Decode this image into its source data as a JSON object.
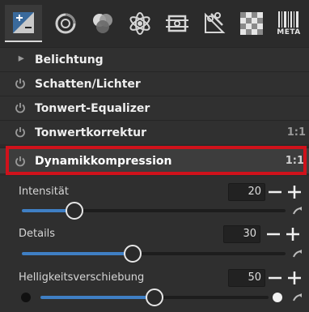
{
  "toolbar": {
    "tabs": [
      {
        "name": "exposure-tab-icon",
        "active": true
      },
      {
        "name": "detail-tab-icon",
        "active": false
      },
      {
        "name": "color-tab-icon",
        "active": false
      },
      {
        "name": "advanced-tab-icon",
        "active": false
      },
      {
        "name": "transform-tab-icon",
        "active": false
      },
      {
        "name": "raw-tab-icon",
        "active": false
      },
      {
        "name": "metadata-tab-icon",
        "active": false
      }
    ],
    "meta_label": "META"
  },
  "tools": [
    {
      "label": "Belichtung",
      "icon": "triangle-expand-icon",
      "ratio": ""
    },
    {
      "label": "Schatten/Lichter",
      "icon": "power-icon",
      "ratio": ""
    },
    {
      "label": "Tonwert-Equalizer",
      "icon": "power-icon",
      "ratio": ""
    },
    {
      "label": "Tonwertkorrektur",
      "icon": "power-icon",
      "ratio": "1:1"
    },
    {
      "label": "Dynamikkompression",
      "icon": "power-icon",
      "ratio": "1:1",
      "expanded": true,
      "highlighted": true
    }
  ],
  "sliders": [
    {
      "label": "Intensität",
      "value": "20",
      "fraction": 0.2,
      "has_dots": false
    },
    {
      "label": "Details",
      "value": "30",
      "fraction": 0.42,
      "has_dots": false
    },
    {
      "label": "Helligkeitsverschiebung",
      "value": "50",
      "fraction": 0.5,
      "has_dots": true
    }
  ],
  "colors": {
    "accent": "#3f7fc4",
    "highlight_border": "#d0121b",
    "background": "#2b2b2b"
  }
}
